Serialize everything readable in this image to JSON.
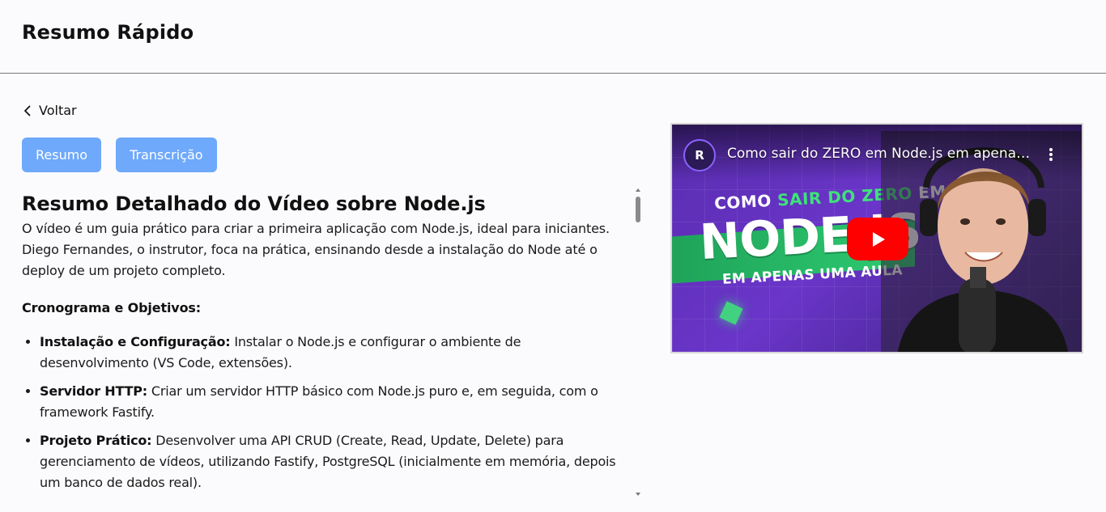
{
  "header": {
    "title": "Resumo Rápido"
  },
  "nav": {
    "back_label": "Voltar"
  },
  "tabs": [
    {
      "label": "Resumo"
    },
    {
      "label": "Transcrição"
    }
  ],
  "summary": {
    "title": "Resumo Detalhado do Vídeo sobre Node.js",
    "intro": "O vídeo é um guia prático para criar a primeira aplicação com Node.js, ideal para iniciantes. Diego Fernandes, o instrutor, foca na prática, ensinando desde a instalação do Node até o deploy de um projeto completo.",
    "section_heading": "Cronograma e Objetivos:",
    "topics": [
      {
        "label": "Instalação e Configuração:",
        "text": " Instalar o Node.js e configurar o ambiente de desenvolvimento (VS Code, extensões)."
      },
      {
        "label": "Servidor HTTP:",
        "text": " Criar um servidor HTTP básico com Node.js puro e, em seguida, com o framework Fastify."
      },
      {
        "label": "Projeto Prático:",
        "text": " Desenvolver uma API CRUD (Create, Read, Update, Delete) para gerenciamento de vídeos, utilizando Fastify, PostgreSQL (inicialmente em memória, depois um banco de dados real)."
      }
    ]
  },
  "video": {
    "title": "Como sair do ZERO em Node.js em apenas uma aula",
    "channel_initials": "R",
    "thumbnail": {
      "line1_prefix": "COMO ",
      "line1_accent": "SAIR DO ZERO",
      "line1_suffix": " EM",
      "big_text": "NODE.JS",
      "line2": "EM APENAS UMA AULA"
    },
    "play_icon": "play-icon",
    "more_icon": "more-vertical-icon"
  },
  "colors": {
    "tab_bg": "#6ea9fb",
    "youtube_red": "#ff0000",
    "accent_green": "#3ee27a"
  }
}
